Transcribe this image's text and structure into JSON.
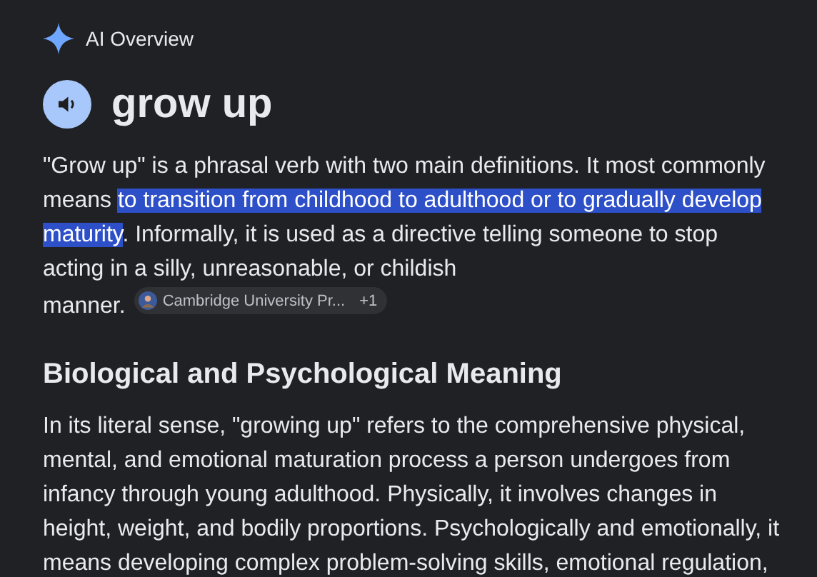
{
  "header": {
    "title": "AI Overview"
  },
  "term": {
    "title": "grow up"
  },
  "summary": {
    "lines": [
      [
        {
          "text": "\"Grow up\" is a phrasal verb with two main definitions. It most commonly",
          "highlighted": false
        }
      ],
      [
        {
          "text": "means ",
          "highlighted": false
        },
        {
          "text": "to transition from childhood to adulthood or to gradually develop",
          "highlighted": true
        }
      ],
      [
        {
          "text": "maturity",
          "highlighted": true
        },
        {
          "text": ". Informally, it is used as a directive telling someone to stop",
          "highlighted": false
        }
      ],
      [
        {
          "text": "acting in a silly, unreasonable, or childish",
          "highlighted": false
        }
      ],
      [
        {
          "text": "manner.",
          "highlighted": false
        }
      ]
    ],
    "source": {
      "label": "Cambridge University Pr...",
      "count": "+1"
    }
  },
  "section": {
    "heading": "Biological and Psychological Meaning",
    "lines": [
      "In its literal sense, \"growing up\" refers to the comprehensive physical,",
      "mental, and emotional maturation process a person undergoes from",
      "infancy through young adulthood. Physically, it involves changes in",
      "height, weight, and bodily proportions. Psychologically and emotionally, it",
      "means developing complex problem-solving skills, emotional regulation,"
    ]
  }
}
